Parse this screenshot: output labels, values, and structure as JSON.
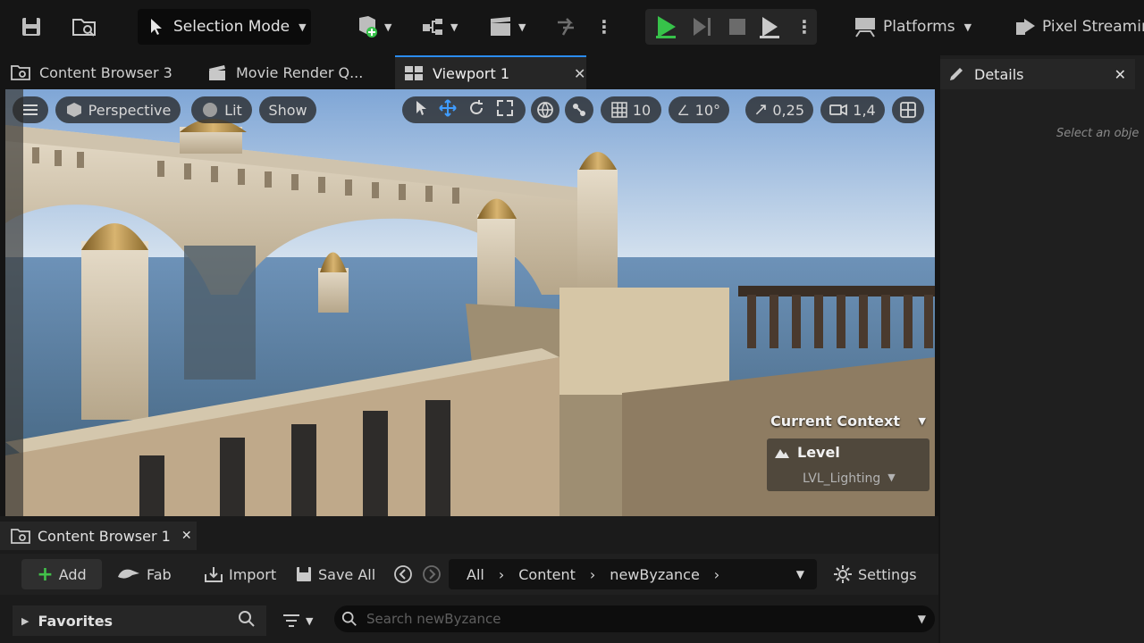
{
  "toolbar": {
    "mode_label": "Selection Mode",
    "platforms_label": "Platforms",
    "pixel_streaming_label": "Pixel Streaming"
  },
  "tabs": [
    {
      "label": "Content Browser 3",
      "icon": "folder-icon"
    },
    {
      "label": "Movie Render Q...",
      "icon": "clapperboard-icon"
    },
    {
      "label": "Viewport 1",
      "icon": "viewport-icon",
      "active": true
    }
  ],
  "viewport": {
    "perspective_label": "Perspective",
    "lit_label": "Lit",
    "show_label": "Show",
    "grid_snap": "10",
    "rotation_snap": "10°",
    "scale_snap": "0,25",
    "camera_speed": "1,4",
    "context": {
      "title": "Current Context",
      "level_label": "Level",
      "level_name": "LVL_Lighting"
    }
  },
  "details": {
    "title": "Details",
    "hint": "Select an obje"
  },
  "content_browser": {
    "tab_label": "Content Browser 1",
    "add_label": "Add",
    "fab_label": "Fab",
    "import_label": "Import",
    "save_all_label": "Save All",
    "path": [
      "All",
      "Content",
      "newByzance"
    ],
    "settings_label": "Settings",
    "favorites_label": "Favorites",
    "search_placeholder": "Search newByzance"
  },
  "colors": {
    "accent": "#2b8cf0",
    "play_green": "#37c24a",
    "add_green": "#42c24a"
  }
}
